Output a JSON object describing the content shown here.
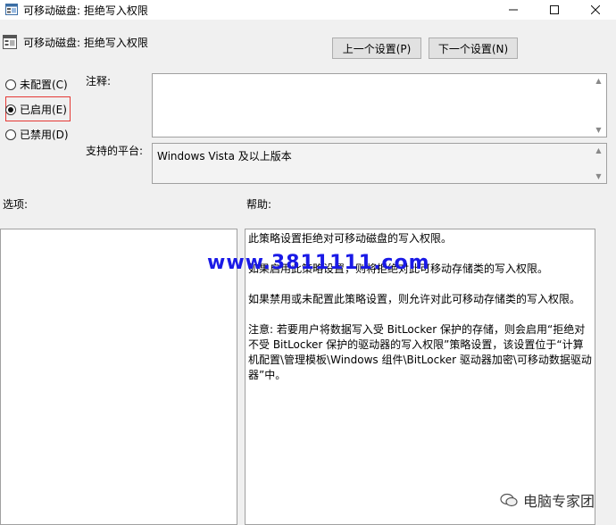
{
  "window": {
    "title": "可移动磁盘: 拒绝写入权限",
    "min_icon": "minimize-icon",
    "max_icon": "maximize-icon",
    "close_icon": "close-icon"
  },
  "header": {
    "policy_title": "可移动磁盘: 拒绝写入权限",
    "prev_label": "上一个设置(P)",
    "next_label": "下一个设置(N)"
  },
  "state": {
    "options": [
      {
        "label": "未配置(C)",
        "selected": false
      },
      {
        "label": "已启用(E)",
        "selected": true
      },
      {
        "label": "已禁用(D)",
        "selected": false
      }
    ],
    "highlight_color": "#e53935"
  },
  "comment": {
    "label": "注释:",
    "value": ""
  },
  "platform": {
    "label": "支持的平台:",
    "value": "Windows Vista 及以上版本"
  },
  "options_label": "选项:",
  "help": {
    "label": "帮助:",
    "paragraphs": [
      "此策略设置拒绝对可移动磁盘的写入权限。",
      "如果启用此策略设置，则将拒绝对此可移动存储类的写入权限。",
      "如果禁用或未配置此策略设置，则允许对此可移动存储类的写入权限。",
      "注意: 若要用户将数据写入受 BitLocker 保护的存储，则会启用“拒绝对不受 BitLocker 保护的驱动器的写入权限”策略设置，该设置位于“计算机配置\\管理模板\\Windows 组件\\BitLocker 驱动器加密\\可移动数据驱动器”中。"
    ]
  },
  "overlay": {
    "watermark": "www.3811111.com",
    "brand": "电脑专家团",
    "brand_color": "#1a1ae6"
  }
}
